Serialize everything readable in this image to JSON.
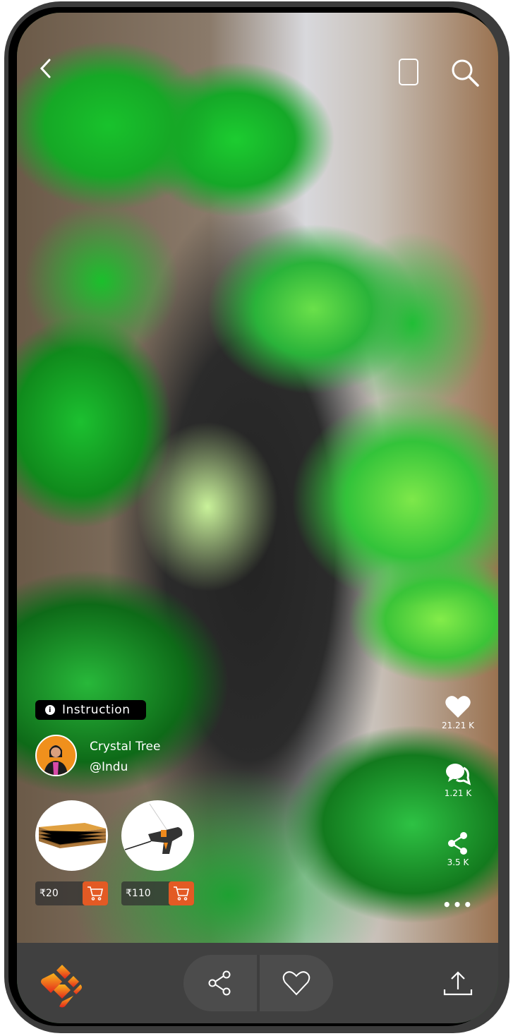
{
  "header": {
    "back_icon": "chevron-left-icon",
    "device_icon": "phone-outline-icon",
    "search_icon": "search-icon"
  },
  "post": {
    "instruction_label": "Instruction",
    "title": "Crystal Tree",
    "handle": "@Indu"
  },
  "products": [
    {
      "name": "cardboard-sheets",
      "price": "₹20"
    },
    {
      "name": "glue-gun",
      "price": "₹110"
    }
  ],
  "stats": {
    "likes": "21.21 K",
    "comments": "1.21 K",
    "shares": "3.5 K"
  },
  "colors": {
    "cart": "#e35a24",
    "bottom_bar": "#404040",
    "logo_top": "#f9b51c",
    "logo_bottom": "#e3261c"
  }
}
